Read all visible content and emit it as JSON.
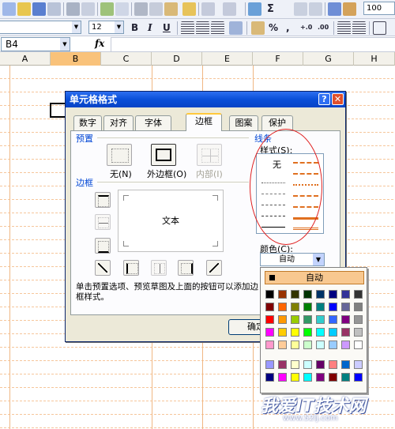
{
  "toolbar": {
    "font_size": "12",
    "zoom": "100",
    "sum_symbol": "Σ",
    "percent_symbol": "%",
    "comma_symbol": ",",
    "inc_decimal": "+.0",
    "dec_decimal": ".00",
    "bold": "B",
    "italic": "I",
    "underline": "U"
  },
  "formula_bar": {
    "name_box": "B4",
    "fx": "fx"
  },
  "grid": {
    "columns": [
      "A",
      "B",
      "C",
      "D",
      "E",
      "F",
      "G",
      "H"
    ],
    "selected_column": "B"
  },
  "dialog": {
    "title": "单元格格式",
    "tabs": [
      {
        "label": "数字"
      },
      {
        "label": "对齐"
      },
      {
        "label": "字体"
      },
      {
        "label": "边框",
        "active": true
      },
      {
        "label": "图案"
      },
      {
        "label": "保护"
      }
    ],
    "preset_section": "预置",
    "presets": [
      {
        "label": "无(N)"
      },
      {
        "label": "外边框(O)"
      },
      {
        "label": "内部(I)",
        "disabled": true
      }
    ],
    "border_section": "边框",
    "preview_text": "文本",
    "line_section": "线条",
    "style_label": "样式(S):",
    "style_none": "无",
    "color_label": "颜色(C):",
    "color_value": "自动",
    "hint": "单击预置选项、预览草图及上面的按钮可以添加边框样式。",
    "ok_label": "确定"
  },
  "palette": {
    "auto_label": "自动",
    "rows": [
      [
        "#000000",
        "#993300",
        "#333300",
        "#003300",
        "#003366",
        "#000080",
        "#333399",
        "#333333"
      ],
      [
        "#800000",
        "#FF6600",
        "#808000",
        "#008000",
        "#008080",
        "#0000FF",
        "#666699",
        "#808080"
      ],
      [
        "#FF0000",
        "#FF9900",
        "#99CC00",
        "#339966",
        "#33CCCC",
        "#3366FF",
        "#800080",
        "#969696"
      ],
      [
        "#FF00FF",
        "#FFCC00",
        "#FFFF00",
        "#00FF00",
        "#00FFFF",
        "#00CCFF",
        "#993366",
        "#C0C0C0"
      ],
      [
        "#FF99CC",
        "#FFCC99",
        "#FFFF99",
        "#CCFFCC",
        "#CCFFFF",
        "#99CCFF",
        "#CC99FF",
        "#FFFFFF"
      ],
      [
        "#9999FF",
        "#993366",
        "#FFFFCC",
        "#CCFFFF",
        "#660066",
        "#FF8080",
        "#0066CC",
        "#CCCCFF"
      ],
      [
        "#000080",
        "#FF00FF",
        "#FFFF00",
        "#00FFFF",
        "#800080",
        "#800000",
        "#008080",
        "#0000FF"
      ]
    ]
  },
  "watermark": {
    "text": "我爱IT技术网",
    "url": "www.52ij.com"
  }
}
